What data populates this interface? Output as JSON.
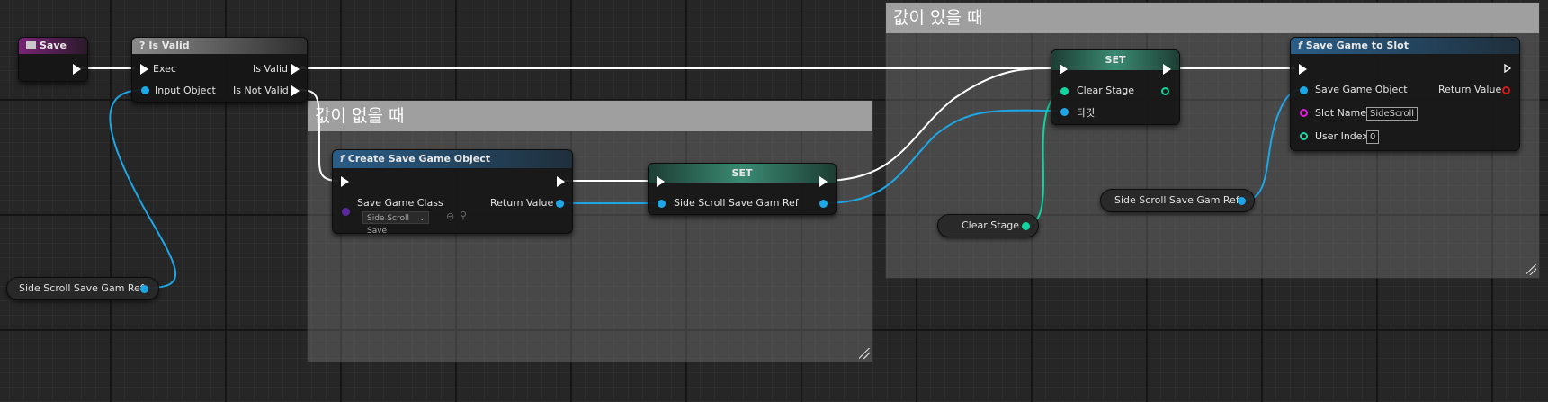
{
  "comments": {
    "has_value": {
      "title": "값이 있을 때"
    },
    "no_value": {
      "title": "값이 없을 때"
    }
  },
  "nodes": {
    "save_event": {
      "title": "Save"
    },
    "is_valid": {
      "title": "Is Valid",
      "exec_in": "Exec",
      "input_object": "Input Object",
      "is_valid_out": "Is Valid",
      "is_not_valid_out": "Is Not Valid"
    },
    "create_save_game_object": {
      "title": "Create Save Game Object",
      "save_game_class": "Save Game Class",
      "class_value": "Side Scroll Save",
      "return_value": "Return Value"
    },
    "set_ref": {
      "title": "SET",
      "pin_label": "Side Scroll Save Gam Ref"
    },
    "set_stage": {
      "title": "SET",
      "clear_stage": "Clear Stage",
      "target": "타깃"
    },
    "save_game_to_slot": {
      "title": "Save Game to Slot",
      "save_game_object": "Save Game Object",
      "return_value": "Return Value",
      "slot_name": "Slot Name",
      "slot_name_value": "SideScroll",
      "user_index": "User Index",
      "user_index_value": "0"
    },
    "var_ref_left": {
      "label": "Side Scroll Save Gam Ref"
    },
    "var_clear_stage": {
      "label": "Clear Stage"
    },
    "var_ref_right": {
      "label": "Side Scroll Save Gam Ref"
    }
  },
  "colors": {
    "exec_wire": "#ffffff",
    "object_wire": "#1ea7e6",
    "bool_wire": "#10d5a0",
    "event_header": "#7a2377",
    "function_header": "#2a5d86"
  }
}
